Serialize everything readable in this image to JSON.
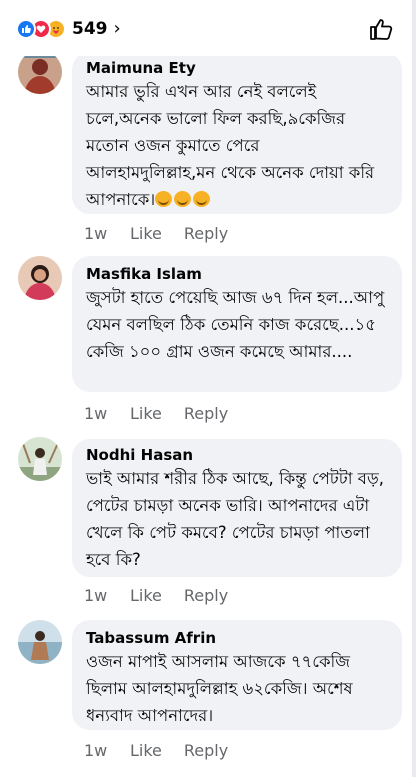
{
  "header": {
    "reaction_count": "549",
    "chevron": "›"
  },
  "comments": [
    {
      "name": "Maimuna Ety",
      "text": "আমার ভুরি এখন আর নেই বললেই চলে,অনেক ভালো ফিল করছি,৯কেজির মতোন ওজন কুমাতে পেরে আলহামদুলিল্লাহ,মন থেকে অনেক দোয়া করি আপনাকে।",
      "time": "1w",
      "like": "Like",
      "reply": "Reply",
      "emoji_count": 3
    },
    {
      "name": "Masfika Islam",
      "text": "জুসটা হাতে পেয়েছি আজ ৬৭ দিন হল...আপু যেমন বলছিল ঠিক তেমনি কাজ করেছে...১৫ কেজি ১০০ গ্রাম ওজন কমেছে আমার....",
      "time": "1w",
      "like": "Like",
      "reply": "Reply"
    },
    {
      "name": "Nodhi Hasan",
      "text": "ভাই আমার শরীর ঠিক আছে, কিন্তু পেটটা বড়, পেটের চামড়া অনেক ভারি। আপনাদের এটা খেলে কি পেট কমবে? পেটের চামড়া পাতলা হবে কি?",
      "time": "1w",
      "like": "Like",
      "reply": "Reply"
    },
    {
      "name": "Tabassum Afrin",
      "text": "ওজন মাপাই আসলাম আজকে ৭৭কেজি ছিলাম আলহামদুলিল্লাহ ৬২কেজি। অশেষ ধন্যবাদ আপনাদের।",
      "time": "1w",
      "like": "Like",
      "reply": "Reply"
    }
  ]
}
